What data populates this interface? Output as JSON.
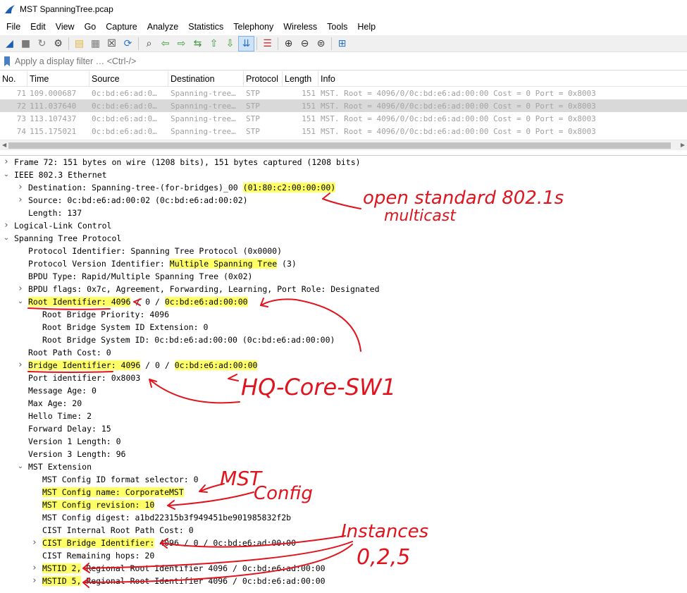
{
  "window": {
    "title": "MST SpanningTree.pcap"
  },
  "menu": [
    "File",
    "Edit",
    "View",
    "Go",
    "Capture",
    "Analyze",
    "Statistics",
    "Telephony",
    "Wireless",
    "Tools",
    "Help"
  ],
  "toolbar": {
    "icons": [
      "shark-fin-icon",
      "stop-icon",
      "restart-icon",
      "options-gear-icon",
      "open-file-icon",
      "save-icon",
      "close-file-icon",
      "reload-icon",
      "find-icon",
      "go-back-icon",
      "go-forward-icon",
      "go-to-packet-icon",
      "first-packet-icon",
      "last-packet-icon",
      "autoscroll-icon",
      "colorize-icon",
      "zoom-in-icon",
      "zoom-out-icon",
      "zoom-normal-icon",
      "resize-columns-icon"
    ]
  },
  "filter": {
    "placeholder": "Apply a display filter … <Ctrl-/>"
  },
  "packet_list": {
    "columns": [
      "No.",
      "Time",
      "Source",
      "Destination",
      "Protocol",
      "Length",
      "Info"
    ],
    "rows": [
      {
        "no": "71",
        "time": "109.000687",
        "src": "0c:bd:e6:ad:0…",
        "dst": "Spanning-tree…",
        "proto": "STP",
        "len": "151",
        "info": "MST. Root = 4096/0/0c:bd:e6:ad:00:00  Cost = 0  Port = 0x8003"
      },
      {
        "no": "72",
        "time": "111.037640",
        "src": "0c:bd:e6:ad:0…",
        "dst": "Spanning-tree…",
        "proto": "STP",
        "len": "151",
        "info": "MST. Root = 4096/0/0c:bd:e6:ad:00:00  Cost = 0  Port = 0x8003"
      },
      {
        "no": "73",
        "time": "113.107437",
        "src": "0c:bd:e6:ad:0…",
        "dst": "Spanning-tree…",
        "proto": "STP",
        "len": "151",
        "info": "MST. Root = 4096/0/0c:bd:e6:ad:00:00  Cost = 0  Port = 0x8003"
      },
      {
        "no": "74",
        "time": "115.175021",
        "src": "0c:bd:e6:ad:0…",
        "dst": "Spanning-tree…",
        "proto": "STP",
        "len": "151",
        "info": "MST. Root = 4096/0/0c:bd:e6:ad:00:00  Cost = 0  Port = 0x8003"
      }
    ]
  },
  "details": [
    {
      "t": "c",
      "l": 0,
      "s": [
        [
          "Frame 72: 151 bytes on wire (1208 bits), 151 bytes captured (1208 bits)"
        ]
      ]
    },
    {
      "t": "e",
      "l": 0,
      "s": [
        [
          "IEEE 802.3 Ethernet"
        ]
      ]
    },
    {
      "t": "c",
      "l": 1,
      "s": [
        [
          "Destination: Spanning-tree-(for-bridges)_00 "
        ],
        [
          "(01:80:c2:00:00:00)",
          "h"
        ]
      ]
    },
    {
      "t": "c",
      "l": 1,
      "s": [
        [
          "Source: 0c:bd:e6:ad:00:02 (0c:bd:e6:ad:00:02)"
        ]
      ]
    },
    {
      "t": "",
      "l": 1,
      "s": [
        [
          "Length: 137"
        ]
      ]
    },
    {
      "t": "c",
      "l": 0,
      "s": [
        [
          "Logical-Link Control"
        ]
      ]
    },
    {
      "t": "e",
      "l": 0,
      "s": [
        [
          "Spanning Tree Protocol"
        ]
      ]
    },
    {
      "t": "",
      "l": 1,
      "s": [
        [
          "Protocol Identifier: Spanning Tree Protocol (0x0000)"
        ]
      ]
    },
    {
      "t": "",
      "l": 1,
      "s": [
        [
          "Protocol Version Identifier: "
        ],
        [
          "Multiple Spanning Tree",
          "h"
        ],
        [
          " (3)"
        ]
      ]
    },
    {
      "t": "",
      "l": 1,
      "s": [
        [
          "BPDU Type: Rapid/Multiple Spanning Tree (0x02)"
        ]
      ]
    },
    {
      "t": "c",
      "l": 1,
      "s": [
        [
          "BPDU flags: 0x7c, Agreement, Forwarding, Learning, Port Role: Designated"
        ]
      ]
    },
    {
      "t": "e",
      "l": 1,
      "s": [
        [
          "Root Identifier: 4096",
          "h"
        ],
        [
          " / 0 / "
        ],
        [
          "0c:bd:e6:ad:00:00",
          "h"
        ]
      ]
    },
    {
      "t": "",
      "l": 2,
      "s": [
        [
          "Root Bridge Priority: 4096"
        ]
      ]
    },
    {
      "t": "",
      "l": 2,
      "s": [
        [
          "Root Bridge System ID Extension: 0"
        ]
      ]
    },
    {
      "t": "",
      "l": 2,
      "s": [
        [
          "Root Bridge System ID: 0c:bd:e6:ad:00:00 (0c:bd:e6:ad:00:00)"
        ]
      ]
    },
    {
      "t": "",
      "l": 1,
      "s": [
        [
          "Root Path Cost: 0"
        ]
      ]
    },
    {
      "t": "c",
      "l": 1,
      "s": [
        [
          "Bridge Identifier: 4096",
          "h"
        ],
        [
          " / 0 / "
        ],
        [
          "0c:bd:e6:ad:00:00",
          "h"
        ]
      ]
    },
    {
      "t": "",
      "l": 1,
      "s": [
        [
          "Port identifier: 0x8003"
        ]
      ]
    },
    {
      "t": "",
      "l": 1,
      "s": [
        [
          "Message Age: 0"
        ]
      ]
    },
    {
      "t": "",
      "l": 1,
      "s": [
        [
          "Max Age: 20"
        ]
      ]
    },
    {
      "t": "",
      "l": 1,
      "s": [
        [
          "Hello Time: 2"
        ]
      ]
    },
    {
      "t": "",
      "l": 1,
      "s": [
        [
          "Forward Delay: 15"
        ]
      ]
    },
    {
      "t": "",
      "l": 1,
      "s": [
        [
          "Version 1 Length: 0"
        ]
      ]
    },
    {
      "t": "",
      "l": 1,
      "s": [
        [
          "Version 3 Length: 96"
        ]
      ]
    },
    {
      "t": "e",
      "l": 1,
      "s": [
        [
          "MST Extension"
        ]
      ]
    },
    {
      "t": "",
      "l": 2,
      "s": [
        [
          "MST Config ID format selector: 0"
        ]
      ]
    },
    {
      "t": "",
      "l": 2,
      "s": [
        [
          "MST Config name: CorporateMST",
          "h"
        ]
      ]
    },
    {
      "t": "",
      "l": 2,
      "s": [
        [
          "MST Config revision: 10",
          "h"
        ]
      ]
    },
    {
      "t": "",
      "l": 2,
      "s": [
        [
          "MST Config digest: a1bd22315b3f949451be901985832f2b"
        ]
      ]
    },
    {
      "t": "",
      "l": 2,
      "s": [
        [
          "CIST Internal Root Path Cost: 0"
        ]
      ]
    },
    {
      "t": "c",
      "l": 2,
      "s": [
        [
          "CIST Bridge Identifier:",
          "h"
        ],
        [
          " 4096 / 0 / 0c:bd:e6:ad:00:00"
        ]
      ]
    },
    {
      "t": "",
      "l": 2,
      "s": [
        [
          "CIST Remaining hops: 20"
        ]
      ]
    },
    {
      "t": "c",
      "l": 2,
      "s": [
        [
          "MSTID 2,",
          "h"
        ],
        [
          " Regional Root Identifier 4096 / 0c:bd:e6:ad:00:00"
        ]
      ]
    },
    {
      "t": "c",
      "l": 2,
      "s": [
        [
          "MSTID 5,",
          "h"
        ],
        [
          " Regional Root Identifier 4096 / 0c:bd:e6:ad:00:00"
        ]
      ]
    }
  ],
  "annotations": {
    "multicast_line1": "open standard 802.1s",
    "multicast_line2": "multicast",
    "switch_name": "HQ-Core-SW1",
    "mst_line1": "MST",
    "mst_line2": "Config",
    "instances_line1": "Instances",
    "instances_line2": "0,2,5"
  },
  "colors": {
    "highlight": "#ffff66",
    "ink": "#e0141e",
    "selected_row": "#d9d9d9"
  }
}
